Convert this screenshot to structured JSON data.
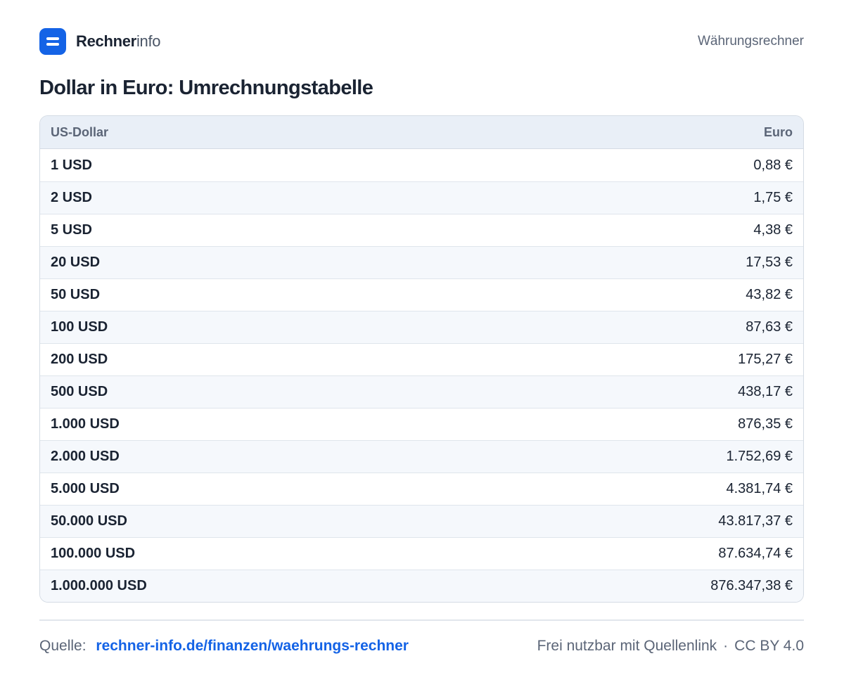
{
  "brand": {
    "name_strong": "Rechner",
    "name_light": "info"
  },
  "header": {
    "nav_link": "Währungsrechner"
  },
  "page": {
    "title": "Dollar in Euro: Umrechnungstabelle"
  },
  "table": {
    "headers": {
      "left": "US-Dollar",
      "right": "Euro"
    },
    "rows": [
      {
        "usd": "1 USD",
        "eur": "0,88 €"
      },
      {
        "usd": "2 USD",
        "eur": "1,75 €"
      },
      {
        "usd": "5 USD",
        "eur": "4,38 €"
      },
      {
        "usd": "20 USD",
        "eur": "17,53 €"
      },
      {
        "usd": "50 USD",
        "eur": "43,82 €"
      },
      {
        "usd": "100 USD",
        "eur": "87,63 €"
      },
      {
        "usd": "200 USD",
        "eur": "175,27 €"
      },
      {
        "usd": "500 USD",
        "eur": "438,17 €"
      },
      {
        "usd": "1.000 USD",
        "eur": "876,35 €"
      },
      {
        "usd": "2.000 USD",
        "eur": "1.752,69 €"
      },
      {
        "usd": "5.000 USD",
        "eur": "4.381,74 €"
      },
      {
        "usd": "50.000 USD",
        "eur": "43.817,37 €"
      },
      {
        "usd": "100.000 USD",
        "eur": "87.634,74 €"
      },
      {
        "usd": "1.000.000 USD",
        "eur": "876.347,38 €"
      }
    ]
  },
  "footer": {
    "source_label": "Quelle:",
    "source_link": "rechner-info.de/finanzen/waehrungs-rechner",
    "license_note": "Frei nutzbar mit Quellenlink",
    "separator": "·",
    "license": "CC BY 4.0"
  },
  "colors": {
    "accent": "#1463e6",
    "header_bg": "#e9eff7",
    "alt_row_bg": "#f5f8fc",
    "text": "#1a2332",
    "muted": "#5b6577"
  },
  "icons": {
    "logo": "equals-logo-icon"
  }
}
